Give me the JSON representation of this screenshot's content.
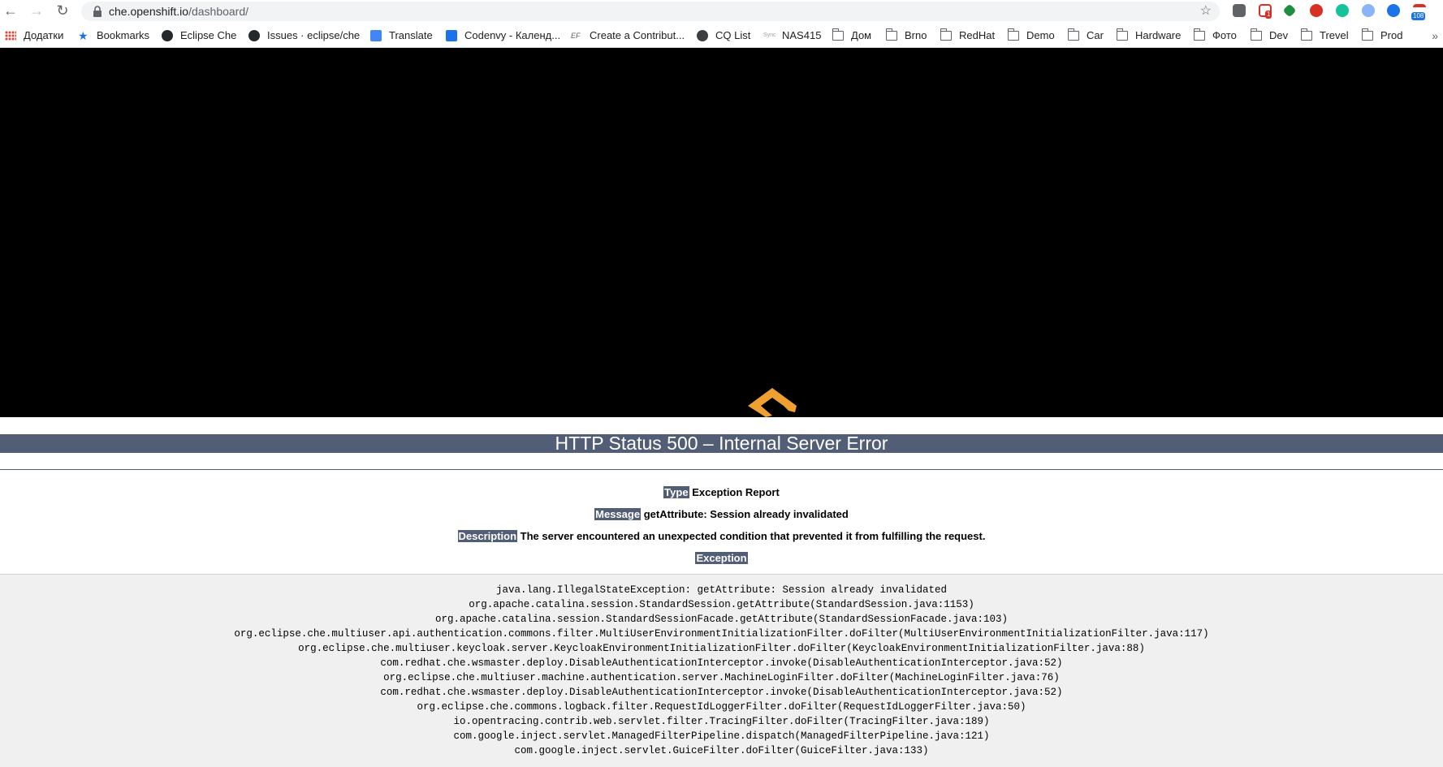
{
  "browser": {
    "url_host": "che.openshift.io",
    "url_path": "/dashboard/",
    "extension_badges": {
      "gmail": "1",
      "calendar": "108"
    },
    "bookmarks": [
      {
        "label": "Додатки",
        "icon": "apps-icon"
      },
      {
        "label": "Bookmarks",
        "icon": "star-icon"
      },
      {
        "label": "Eclipse Che",
        "icon": "github-icon"
      },
      {
        "label": "Issues · eclipse/che",
        "icon": "github-icon"
      },
      {
        "label": "Translate",
        "icon": "translate-icon"
      },
      {
        "label": "Codenvy - Календ...",
        "icon": "calendar-icon"
      },
      {
        "label": "Create a Contribut...",
        "icon": "ef-icon"
      },
      {
        "label": "CQ List",
        "icon": "globe-icon"
      },
      {
        "label": "NAS415",
        "icon": "sync-icon"
      },
      {
        "label": "Дом",
        "icon": "folder-icon"
      },
      {
        "label": "Brno",
        "icon": "folder-icon"
      },
      {
        "label": "RedHat",
        "icon": "folder-icon"
      },
      {
        "label": "Demo",
        "icon": "folder-icon"
      },
      {
        "label": "Car",
        "icon": "folder-icon"
      },
      {
        "label": "Hardware",
        "icon": "folder-icon"
      },
      {
        "label": "Фото",
        "icon": "folder-icon"
      },
      {
        "label": "Dev",
        "icon": "folder-icon"
      },
      {
        "label": "Trevel",
        "icon": "folder-icon"
      },
      {
        "label": "Prod",
        "icon": "folder-icon"
      }
    ],
    "more_bookmarks": "»"
  },
  "error_page": {
    "title": "HTTP Status 500 – Internal Server Error",
    "type_label": "Type",
    "type_value": "Exception Report",
    "message_label": "Message",
    "message_value": "getAttribute: Session already invalidated",
    "description_label": "Description",
    "description_value": "The server encountered an unexpected condition that prevented it from fulfilling the request.",
    "exception_label": "Exception",
    "stack_trace": [
      "java.lang.IllegalStateException: getAttribute: Session already invalidated",
      "org.apache.catalina.session.StandardSession.getAttribute(StandardSession.java:1153)",
      "org.apache.catalina.session.StandardSessionFacade.getAttribute(StandardSessionFacade.java:103)",
      "org.eclipse.che.multiuser.api.authentication.commons.filter.MultiUserEnvironmentInitializationFilter.doFilter(MultiUserEnvironmentInitializationFilter.java:117)",
      "org.eclipse.che.multiuser.keycloak.server.KeycloakEnvironmentInitializationFilter.doFilter(KeycloakEnvironmentInitializationFilter.java:88)",
      "com.redhat.che.wsmaster.deploy.DisableAuthenticationInterceptor.invoke(DisableAuthenticationInterceptor.java:52)",
      "org.eclipse.che.multiuser.machine.authentication.server.MachineLoginFilter.doFilter(MachineLoginFilter.java:76)",
      "com.redhat.che.wsmaster.deploy.DisableAuthenticationInterceptor.invoke(DisableAuthenticationInterceptor.java:52)",
      "org.eclipse.che.commons.logback.filter.RequestIdLoggerFilter.doFilter(RequestIdLoggerFilter.java:50)",
      "io.opentracing.contrib.web.servlet.filter.TracingFilter.doFilter(TracingFilter.java:189)",
      "com.google.inject.servlet.ManagedFilterPipeline.dispatch(ManagedFilterPipeline.java:121)",
      "com.google.inject.servlet.GuiceFilter.doFilter(GuiceFilter.java:133)"
    ]
  },
  "colors": {
    "status_bar": "#525d76",
    "loader": "#f0a030"
  }
}
